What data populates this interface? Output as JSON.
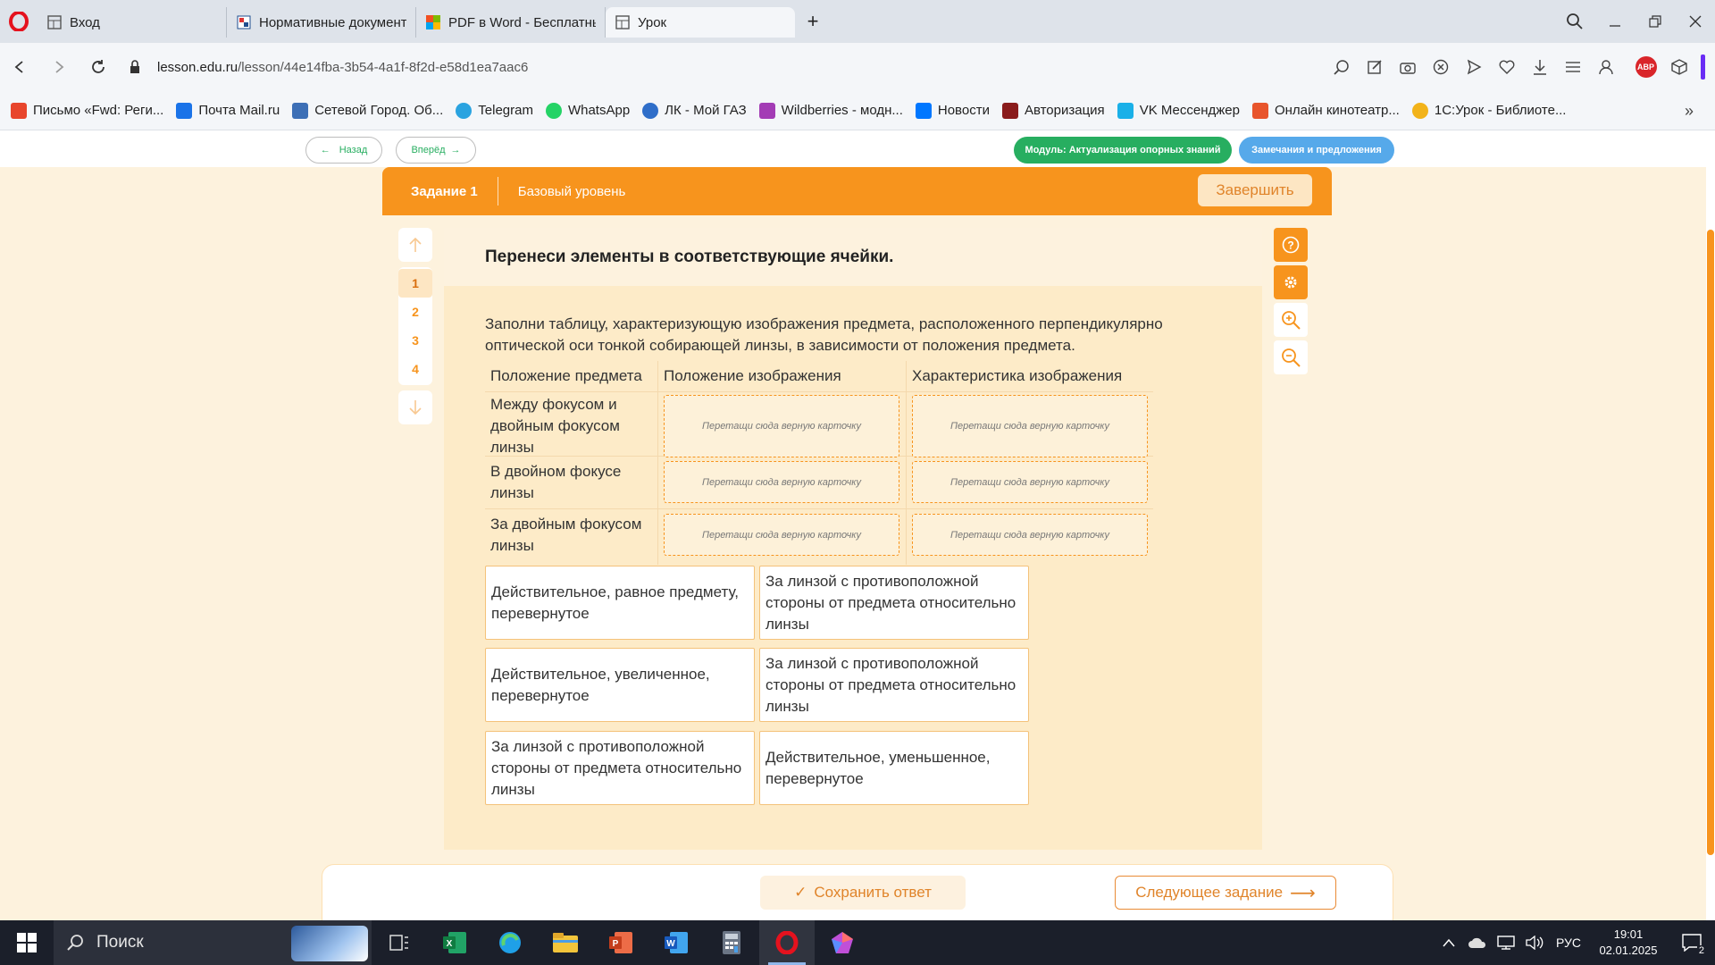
{
  "browser": {
    "tabs": [
      {
        "title": "Вход",
        "active": false
      },
      {
        "title": "Нормативные документы",
        "active": false
      },
      {
        "title": "PDF в Word - Бесплатный",
        "active": false
      },
      {
        "title": "Урок",
        "active": true
      }
    ],
    "new_tab": "+",
    "url_host": "lesson.edu.ru",
    "url_path": "/lesson/44e14fba-3b54-4a1f-8f2d-e58d1ea7aac6",
    "abp_label": "ABP",
    "bookmarks": [
      {
        "label": "Письмо «Fwd: Реги...",
        "color": "#e8452c"
      },
      {
        "label": "Почта Mail.ru",
        "color": "#1a73e8"
      },
      {
        "label": "Сетевой Город. Об...",
        "color": "#3d6fb6"
      },
      {
        "label": "Telegram",
        "color": "#2aa3e0"
      },
      {
        "label": "WhatsApp",
        "color": "#25d366"
      },
      {
        "label": "ЛК - Мой ГАЗ",
        "color": "#2f6ec9"
      },
      {
        "label": "Wildberries - модн...",
        "color": "#a33cb5"
      },
      {
        "label": "Новости",
        "color": "#0077ff"
      },
      {
        "label": "Авторизация",
        "color": "#8a1c1c"
      },
      {
        "label": "VK Мессенджер",
        "color": "#1ab0e8"
      },
      {
        "label": "Онлайн кинотеатр...",
        "color": "#e8552c"
      },
      {
        "label": "1С:Урок - Библиоте...",
        "color": "#f2b31a"
      }
    ]
  },
  "lesson": {
    "nav_back": "Назад",
    "nav_forward": "Вперёд",
    "module_label": "Модуль: Актуализация опорных знаний",
    "feedback_label": "Замечания и предложения",
    "task_label": "Задание 1",
    "level_label": "Базовый уровень",
    "finish_label": "Завершить",
    "task_numbers": [
      "1",
      "2",
      "3",
      "4"
    ],
    "active_task": "1",
    "title": "Перенеси элементы в соответствующие ячейки.",
    "instruction": "Заполни таблицу, характеризующую изображения предмета, расположенного перпендикулярно оптической оси тонкой собирающей линзы, в зависимости от положения предмета.",
    "table": {
      "headers": [
        "Положение предмета",
        "Положение изображения",
        "Характеристика изображения"
      ],
      "rows": [
        "Между фокусом и двойным фокусом линзы",
        "В двойном фокусе линзы",
        "За двойным фокусом линзы"
      ],
      "drop_placeholder": "Перетащи сюда верную карточку"
    },
    "cards": [
      "Действительное, равное предмету, перевернутое",
      "За линзой с противоположной стороны от предмета относительно линзы",
      "Действительное, увеличенное, перевернутое",
      "За линзой с противоположной стороны от предмета относительно линзы",
      "За линзой с противоположной стороны от предмета относительно линзы",
      "Действительное, уменьшенное, перевернутое"
    ],
    "save_label": "Сохранить ответ",
    "next_label": "Следующее задание"
  },
  "taskbar": {
    "search_placeholder": "Поиск",
    "language": "РУС",
    "time": "19:01",
    "date": "02.01.2025",
    "notifications": "2"
  },
  "colors": {
    "accent": "#f7941d",
    "green": "#27ae60",
    "blue": "#56a9ea"
  }
}
